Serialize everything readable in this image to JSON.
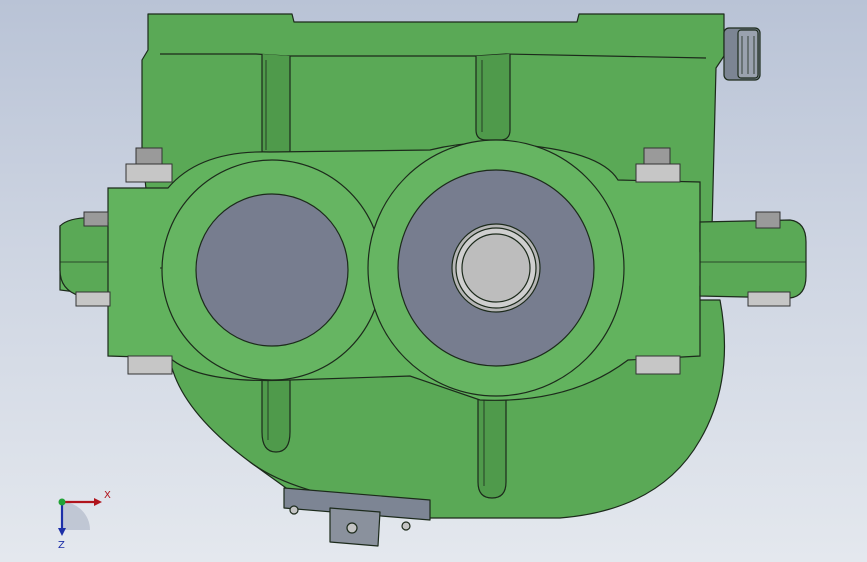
{
  "viewport": {
    "colors": {
      "background_top": "#b9c3d6",
      "background_bottom": "#e4e8ee",
      "housing": "#5aa956",
      "housing_shadow": "#3f8a3c",
      "bore": "#777d8f",
      "bolt": "#c4c4c4",
      "outline": "#1c2a1b"
    }
  },
  "triad": {
    "x_label": "X",
    "z_label": "Z",
    "colors": {
      "x": "#b0141c",
      "y": "#21a336",
      "z": "#1c2fa8"
    }
  }
}
